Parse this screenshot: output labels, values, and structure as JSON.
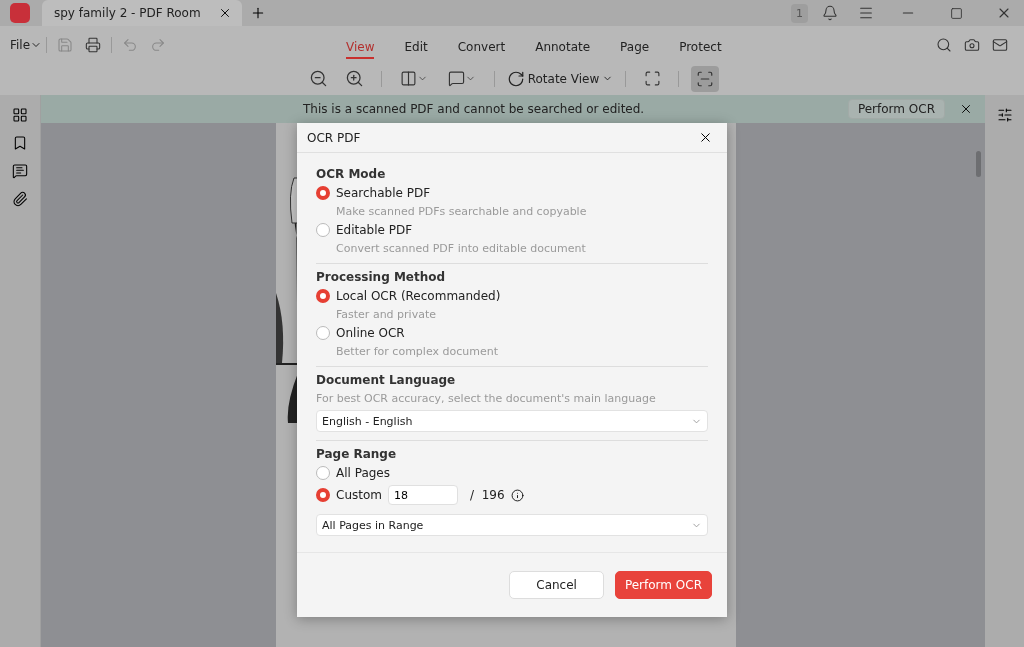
{
  "app_tab": {
    "title": "spy family 2 - PDF Room",
    "badge": "1"
  },
  "menu": {
    "file": "File",
    "tabs": [
      {
        "label": "View",
        "selected": true
      },
      {
        "label": "Edit",
        "selected": false
      },
      {
        "label": "Convert",
        "selected": false
      },
      {
        "label": "Annotate",
        "selected": false
      },
      {
        "label": "Page",
        "selected": false
      },
      {
        "label": "Protect",
        "selected": false
      }
    ]
  },
  "toolbar": {
    "rotate": "Rotate View",
    "scan_selected": true
  },
  "banner": {
    "text": "This is a scanned PDF and cannot be searched or edited.",
    "button": "Perform OCR"
  },
  "dialog": {
    "title": "OCR PDF",
    "sections": [
      {
        "kind": "radios",
        "heading": "OCR Mode",
        "options": [
          {
            "label": "Searchable PDF",
            "description": "Make scanned PDFs searchable and copyable",
            "selected": true
          },
          {
            "label": "Editable PDF",
            "description": "Convert scanned PDF into editable document",
            "selected": false
          }
        ]
      },
      {
        "kind": "radios",
        "heading": "Processing Method",
        "options": [
          {
            "label": "Local OCR (Recommanded)",
            "description": "Faster and private",
            "selected": true
          },
          {
            "label": "Online OCR",
            "description": "Better for complex document",
            "selected": false
          }
        ]
      },
      {
        "kind": "language",
        "heading": "Document Language",
        "hint": "For best OCR accuracy, select the document's main language",
        "value": "English - English"
      },
      {
        "kind": "range",
        "heading": "Page Range",
        "all_label": "All Pages",
        "all_selected": false,
        "custom_label": "Custom",
        "custom_selected": true,
        "custom_value": "18",
        "total": "/  196",
        "subset": "All Pages in Range"
      }
    ],
    "cancel": "Cancel",
    "confirm": "Perform OCR"
  }
}
